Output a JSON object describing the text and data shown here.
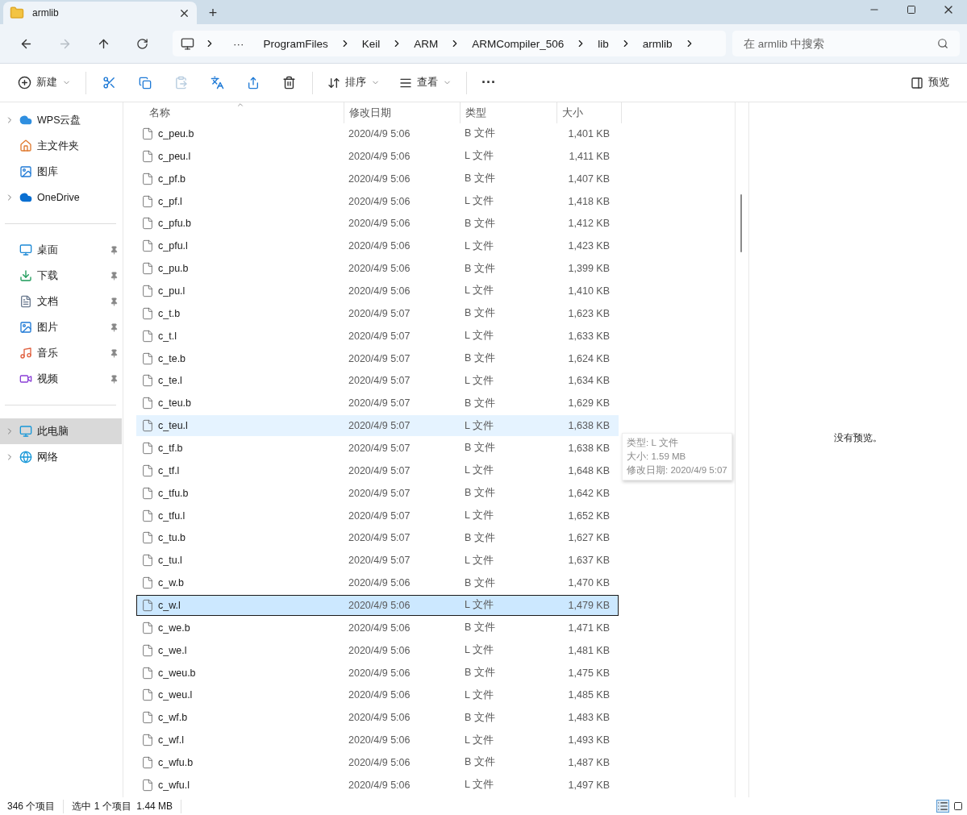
{
  "window": {
    "tab_title": "armlib",
    "new_tab": "+"
  },
  "address_bar": {
    "overflow": "···",
    "crumbs": [
      "ProgramFiles",
      "Keil",
      "ARM",
      "ARMCompiler_506",
      "lib",
      "armlib"
    ]
  },
  "search": {
    "placeholder": "在 armlib 中搜索"
  },
  "toolbar": {
    "new": "新建",
    "sort": "排序",
    "view": "查看",
    "more": "···",
    "preview": "预览"
  },
  "sidebar": {
    "groups": [
      [
        {
          "label": "WPS云盘",
          "expandable": true,
          "pinned": false,
          "selected": false
        },
        {
          "label": "主文件夹",
          "expandable": false,
          "pinned": false,
          "selected": false
        },
        {
          "label": "图库",
          "expandable": false,
          "pinned": false,
          "selected": false
        },
        {
          "label": "OneDrive",
          "expandable": true,
          "pinned": false,
          "selected": false
        }
      ],
      [
        {
          "label": "桌面",
          "expandable": false,
          "pinned": true,
          "selected": false
        },
        {
          "label": "下载",
          "expandable": false,
          "pinned": true,
          "selected": false
        },
        {
          "label": "文档",
          "expandable": false,
          "pinned": true,
          "selected": false
        },
        {
          "label": "图片",
          "expandable": false,
          "pinned": true,
          "selected": false
        },
        {
          "label": "音乐",
          "expandable": false,
          "pinned": true,
          "selected": false
        },
        {
          "label": "视频",
          "expandable": false,
          "pinned": true,
          "selected": false
        }
      ],
      [
        {
          "label": "此电脑",
          "expandable": true,
          "pinned": false,
          "selected": true
        },
        {
          "label": "网络",
          "expandable": true,
          "pinned": false,
          "selected": false
        }
      ]
    ]
  },
  "table": {
    "columns": [
      "名称",
      "修改日期",
      "类型",
      "大小"
    ],
    "rows": [
      {
        "name": "c_peu.b",
        "date": "2020/4/9 5:06",
        "type": "B 文件",
        "size": "1,401 KB",
        "selected": false,
        "hovered": false
      },
      {
        "name": "c_peu.l",
        "date": "2020/4/9 5:06",
        "type": "L 文件",
        "size": "1,411 KB",
        "selected": false,
        "hovered": false
      },
      {
        "name": "c_pf.b",
        "date": "2020/4/9 5:06",
        "type": "B 文件",
        "size": "1,407 KB",
        "selected": false,
        "hovered": false
      },
      {
        "name": "c_pf.l",
        "date": "2020/4/9 5:06",
        "type": "L 文件",
        "size": "1,418 KB",
        "selected": false,
        "hovered": false
      },
      {
        "name": "c_pfu.b",
        "date": "2020/4/9 5:06",
        "type": "B 文件",
        "size": "1,412 KB",
        "selected": false,
        "hovered": false
      },
      {
        "name": "c_pfu.l",
        "date": "2020/4/9 5:06",
        "type": "L 文件",
        "size": "1,423 KB",
        "selected": false,
        "hovered": false
      },
      {
        "name": "c_pu.b",
        "date": "2020/4/9 5:06",
        "type": "B 文件",
        "size": "1,399 KB",
        "selected": false,
        "hovered": false
      },
      {
        "name": "c_pu.l",
        "date": "2020/4/9 5:06",
        "type": "L 文件",
        "size": "1,410 KB",
        "selected": false,
        "hovered": false
      },
      {
        "name": "c_t.b",
        "date": "2020/4/9 5:07",
        "type": "B 文件",
        "size": "1,623 KB",
        "selected": false,
        "hovered": false
      },
      {
        "name": "c_t.l",
        "date": "2020/4/9 5:07",
        "type": "L 文件",
        "size": "1,633 KB",
        "selected": false,
        "hovered": false
      },
      {
        "name": "c_te.b",
        "date": "2020/4/9 5:07",
        "type": "B 文件",
        "size": "1,624 KB",
        "selected": false,
        "hovered": false
      },
      {
        "name": "c_te.l",
        "date": "2020/4/9 5:07",
        "type": "L 文件",
        "size": "1,634 KB",
        "selected": false,
        "hovered": false
      },
      {
        "name": "c_teu.b",
        "date": "2020/4/9 5:07",
        "type": "B 文件",
        "size": "1,629 KB",
        "selected": false,
        "hovered": false
      },
      {
        "name": "c_teu.l",
        "date": "2020/4/9 5:07",
        "type": "L 文件",
        "size": "1,638 KB",
        "selected": false,
        "hovered": true
      },
      {
        "name": "c_tf.b",
        "date": "2020/4/9 5:07",
        "type": "B 文件",
        "size": "1,638 KB",
        "selected": false,
        "hovered": false
      },
      {
        "name": "c_tf.l",
        "date": "2020/4/9 5:07",
        "type": "L 文件",
        "size": "1,648 KB",
        "selected": false,
        "hovered": false
      },
      {
        "name": "c_tfu.b",
        "date": "2020/4/9 5:07",
        "type": "B 文件",
        "size": "1,642 KB",
        "selected": false,
        "hovered": false
      },
      {
        "name": "c_tfu.l",
        "date": "2020/4/9 5:07",
        "type": "L 文件",
        "size": "1,652 KB",
        "selected": false,
        "hovered": false
      },
      {
        "name": "c_tu.b",
        "date": "2020/4/9 5:07",
        "type": "B 文件",
        "size": "1,627 KB",
        "selected": false,
        "hovered": false
      },
      {
        "name": "c_tu.l",
        "date": "2020/4/9 5:07",
        "type": "L 文件",
        "size": "1,637 KB",
        "selected": false,
        "hovered": false
      },
      {
        "name": "c_w.b",
        "date": "2020/4/9 5:06",
        "type": "B 文件",
        "size": "1,470 KB",
        "selected": false,
        "hovered": false
      },
      {
        "name": "c_w.l",
        "date": "2020/4/9 5:06",
        "type": "L 文件",
        "size": "1,479 KB",
        "selected": true,
        "hovered": false
      },
      {
        "name": "c_we.b",
        "date": "2020/4/9 5:06",
        "type": "B 文件",
        "size": "1,471 KB",
        "selected": false,
        "hovered": false
      },
      {
        "name": "c_we.l",
        "date": "2020/4/9 5:06",
        "type": "L 文件",
        "size": "1,481 KB",
        "selected": false,
        "hovered": false
      },
      {
        "name": "c_weu.b",
        "date": "2020/4/9 5:06",
        "type": "B 文件",
        "size": "1,475 KB",
        "selected": false,
        "hovered": false
      },
      {
        "name": "c_weu.l",
        "date": "2020/4/9 5:06",
        "type": "L 文件",
        "size": "1,485 KB",
        "selected": false,
        "hovered": false
      },
      {
        "name": "c_wf.b",
        "date": "2020/4/9 5:06",
        "type": "B 文件",
        "size": "1,483 KB",
        "selected": false,
        "hovered": false
      },
      {
        "name": "c_wf.l",
        "date": "2020/4/9 5:06",
        "type": "L 文件",
        "size": "1,493 KB",
        "selected": false,
        "hovered": false
      },
      {
        "name": "c_wfu.b",
        "date": "2020/4/9 5:06",
        "type": "B 文件",
        "size": "1,487 KB",
        "selected": false,
        "hovered": false
      },
      {
        "name": "c_wfu.l",
        "date": "2020/4/9 5:06",
        "type": "L 文件",
        "size": "1,497 KB",
        "selected": false,
        "hovered": false
      }
    ]
  },
  "tooltip": {
    "lines": [
      "类型: L 文件",
      "大小: 1.59 MB",
      "修改日期: 2020/4/9 5:07"
    ]
  },
  "preview": {
    "message": "没有预览。"
  },
  "status_bar": {
    "count": "346 个项目",
    "selection": "选中 1 个项目  1.44 MB"
  }
}
